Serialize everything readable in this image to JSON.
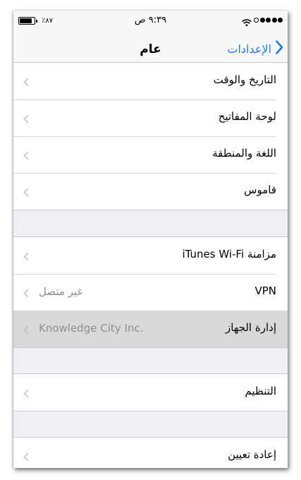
{
  "status_bar": {
    "battery_percent": "٪٨٧",
    "time": "٩:٣٩ ص",
    "signal_dots_filled": 4,
    "signal_dots_total": 5,
    "wifi_icon": "wifi-icon"
  },
  "nav": {
    "title": "عام",
    "back_label": "الإعدادات",
    "accent_color": "#1e7cf2"
  },
  "groups": [
    {
      "items": [
        {
          "label": "التاريخ والوقت",
          "value": ""
        },
        {
          "label": "لوحة المفاتيح",
          "value": ""
        },
        {
          "label": "اللغة والمنطقة",
          "value": ""
        },
        {
          "label": "قاموس",
          "value": ""
        }
      ]
    },
    {
      "items": [
        {
          "label": "مزامنة iTunes Wi-Fi",
          "value": ""
        },
        {
          "label": "VPN",
          "value": "غير متصل"
        },
        {
          "label": "إدارة الجهاز",
          "value": "Knowledge City Inc.",
          "highlighted": true
        }
      ]
    },
    {
      "items": [
        {
          "label": "التنظيم",
          "value": ""
        }
      ]
    },
    {
      "items": [
        {
          "label": "إعادة تعيين",
          "value": ""
        }
      ]
    }
  ]
}
